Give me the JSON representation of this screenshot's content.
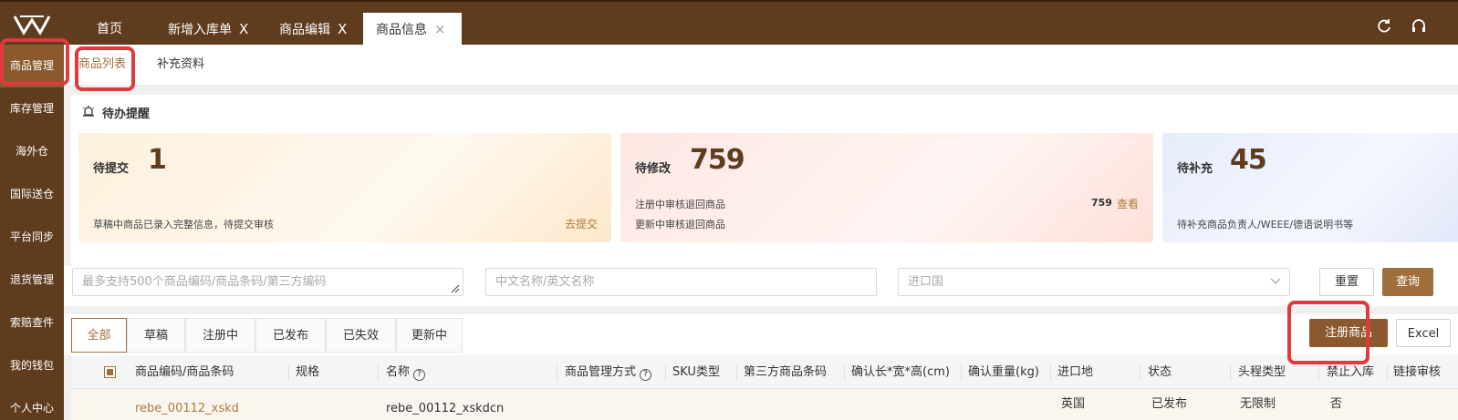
{
  "tabs": [
    {
      "label": "首页",
      "closable": false
    },
    {
      "label": "新增入库单",
      "closable": true
    },
    {
      "label": "商品编辑",
      "closable": true
    },
    {
      "label": "商品信息",
      "closable": true,
      "active": true
    }
  ],
  "close_glyph": "X",
  "close_glyph_active": "×",
  "sidebar": {
    "items": [
      {
        "label": "商品管理",
        "active": true
      },
      {
        "label": "库存管理"
      },
      {
        "label": "海外仓"
      },
      {
        "label": "国际送仓"
      },
      {
        "label": "平台同步"
      },
      {
        "label": "退货管理"
      },
      {
        "label": "索赔查件"
      },
      {
        "label": "我的钱包"
      },
      {
        "label": "个人中心"
      }
    ]
  },
  "subtabs": [
    {
      "label": "商品列表",
      "active": true
    },
    {
      "label": "补充资料"
    }
  ],
  "todo": {
    "title": "待办提醒",
    "cards": [
      {
        "label": "待提交",
        "count": "1",
        "desc1": "草稿中商品已录入完整信息，待提交审核",
        "link": "去提交"
      },
      {
        "label": "待修改",
        "count": "759",
        "desc1": "注册中审核退回商品",
        "desc1_num": "759",
        "desc1_link": "查看",
        "desc2": "更新中审核退回商品"
      },
      {
        "label": "待补充",
        "count": "45",
        "desc1": "待补充商品负责人/WEEE/德语说明书等"
      }
    ]
  },
  "filter": {
    "codes_placeholder": "最多支持500个商品编码/商品条码/第三方编码",
    "name_placeholder": "中文名称/英文名称",
    "country_placeholder": "进口国",
    "reset": "重置",
    "query": "查询"
  },
  "status_tabs": [
    "全部",
    "草稿",
    "注册中",
    "已发布",
    "已失效",
    "更新中"
  ],
  "actions": {
    "register": "注册商品",
    "excel": "Excel"
  },
  "table": {
    "headers": [
      "商品编码/商品条码",
      "规格",
      "名称",
      "商品管理方式",
      "SKU类型",
      "第三方商品条码",
      "确认长*宽*高(cm)",
      "确认重量(kg)",
      "进口地",
      "状态",
      "头程类型",
      "禁止入库",
      "链接审核"
    ],
    "row": {
      "code": "rebe_00112_xskd",
      "name": "rebe_00112_xskdcn",
      "country": "英国",
      "status": "已发布",
      "type": "无限制",
      "forbid": "否"
    }
  },
  "colors": {
    "brand": "#5f3c1e",
    "accent": "#a0703c",
    "highlight": "#e0393e"
  },
  "icons": {
    "refresh": "refresh-icon",
    "headset": "headset-icon",
    "alarm": "alarm-icon",
    "help": "help-circle-icon",
    "chevron": "chevron-down-icon"
  }
}
